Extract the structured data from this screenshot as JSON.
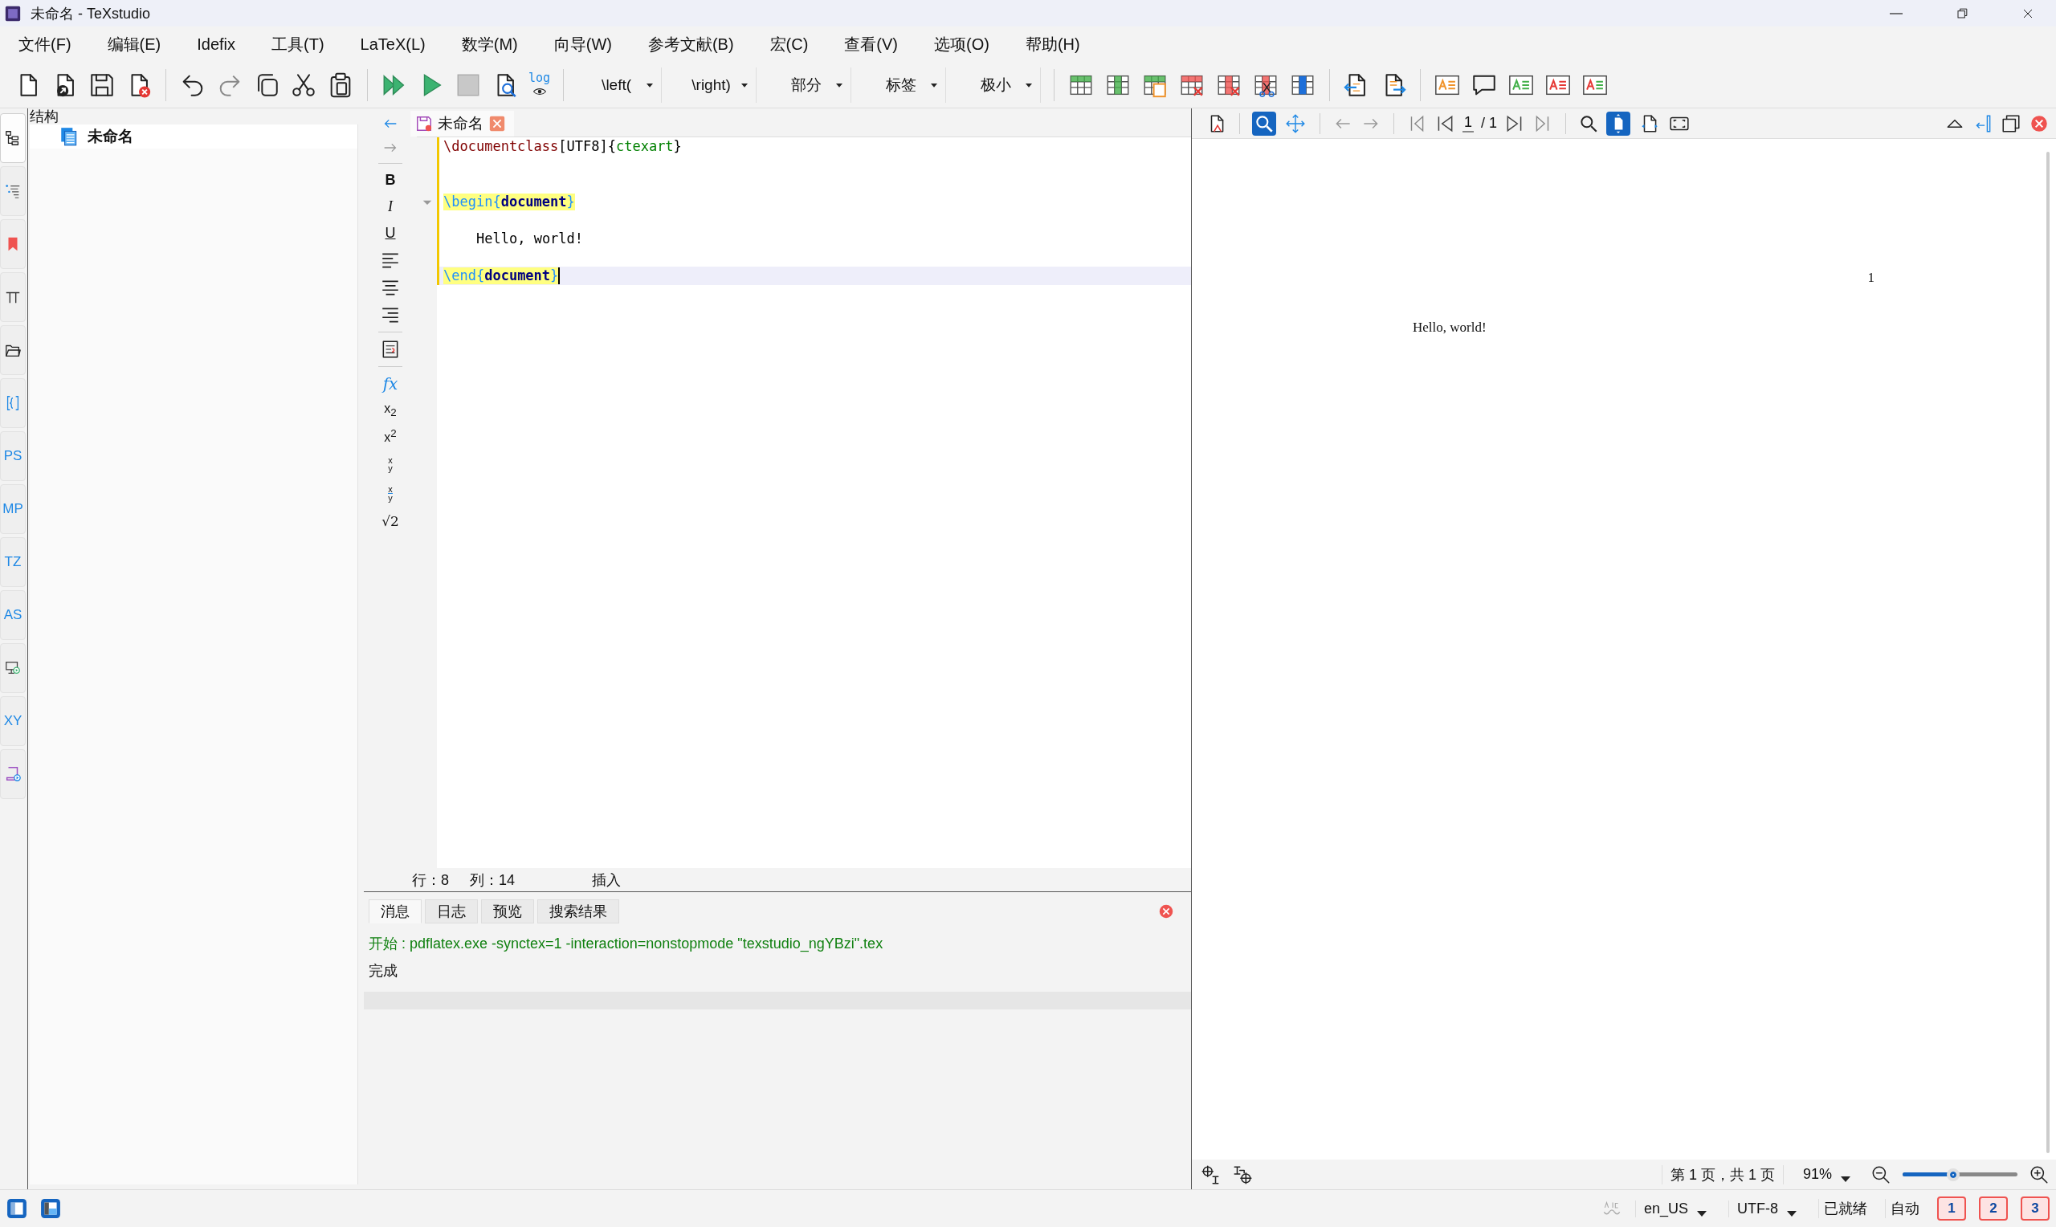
{
  "window": {
    "title": "未命名 - TeXstudio"
  },
  "menu": [
    "文件(F)",
    "编辑(E)",
    "Idefix",
    "工具(T)",
    "LaTeX(L)",
    "数学(M)",
    "向导(W)",
    "参考文献(B)",
    "宏(C)",
    "查看(V)",
    "选项(O)",
    "帮助(H)"
  ],
  "toolbar": {
    "log_label": "log",
    "dropdowns": [
      "\\left(",
      "\\right)",
      "部分",
      "标签",
      "极小"
    ]
  },
  "sidebar": {
    "tabs": [
      {
        "kind": "structure",
        "selected": true
      },
      {
        "kind": "toc",
        "selected": false
      },
      {
        "kind": "bookmark",
        "selected": false
      },
      {
        "kind": "symbols",
        "selected": false
      },
      {
        "kind": "files",
        "selected": false
      },
      {
        "kind": "braces",
        "selected": false
      },
      {
        "kind": "text",
        "label": "PS",
        "selected": false
      },
      {
        "kind": "text",
        "label": "MP",
        "selected": false
      },
      {
        "kind": "text",
        "label": "TZ",
        "selected": false
      },
      {
        "kind": "text",
        "label": "AS",
        "selected": false
      },
      {
        "kind": "presentation",
        "selected": false
      },
      {
        "kind": "text",
        "label": "XY",
        "selected": false
      },
      {
        "kind": "script",
        "selected": false
      }
    ]
  },
  "structure": {
    "title": "结构",
    "items": [
      {
        "label": "未命名"
      }
    ]
  },
  "editor": {
    "tabs": [
      {
        "label": "未命名"
      }
    ],
    "format_buttons": [
      "B",
      "I",
      "U"
    ],
    "math_buttons": [
      {
        "kind": "fx",
        "text": "fx"
      },
      {
        "kind": "sub",
        "text": "x$_{2}$"
      },
      {
        "kind": "sup",
        "text": "x$^{2}$"
      },
      {
        "kind": "frac",
        "num": "x",
        "den": "y"
      },
      {
        "kind": "dfrac",
        "num": "x",
        "den": "y"
      },
      {
        "kind": "sqrt",
        "text": "√2"
      }
    ],
    "lines": [
      {
        "tokens": [
          {
            "text": "\\documentclass",
            "kind": "class"
          },
          {
            "text": "[UTF8]{",
            "kind": "plain"
          },
          {
            "text": "ctexart",
            "kind": "arg"
          },
          {
            "text": "}",
            "kind": "plain"
          }
        ],
        "modified": true
      },
      {
        "modified": true
      },
      {
        "modified": true
      },
      {
        "tokens": [
          {
            "text": "\\begin{",
            "kind": "env"
          },
          {
            "text": "document",
            "kind": "envname"
          },
          {
            "text": "}",
            "kind": "env"
          }
        ],
        "modified": true,
        "foldable": true,
        "match_highlight": true
      },
      {
        "modified": true
      },
      {
        "tokens": [
          {
            "text": "Hello, world!",
            "kind": "plain"
          }
        ],
        "modified": true,
        "indented": true
      },
      {
        "modified": true
      },
      {
        "tokens": [
          {
            "text": "\\end{",
            "kind": "env"
          },
          {
            "text": "document",
            "kind": "envname"
          },
          {
            "text": "}",
            "kind": "env"
          }
        ],
        "modified": true,
        "match_highlight": true,
        "current": true
      }
    ],
    "position": {
      "line_label": "行：",
      "line": "8",
      "col_label": "列：",
      "col": "14",
      "mode": "插入"
    }
  },
  "messages": {
    "tabs": [
      {
        "label": "消息",
        "selected": true
      },
      {
        "label": "日志",
        "selected": false
      },
      {
        "label": "预览",
        "selected": false
      },
      {
        "label": "搜索结果",
        "selected": false
      }
    ],
    "lines": [
      {
        "kind": "info",
        "text": "开始 : pdflatex.exe -synctex=1 -interaction=nonstopmode \"texstudio_ngYBzi\".tex"
      },
      {
        "kind": "plain",
        "text": "完成"
      }
    ]
  },
  "pdf": {
    "tools": [
      {
        "kind": "magnifier",
        "selected": true
      },
      {
        "kind": "scroll",
        "selected": false
      }
    ],
    "page_input": "1",
    "page_total": "/ 1",
    "fit": [
      {
        "kind": "fit-page",
        "selected": true
      },
      {
        "kind": "fit-width",
        "selected": false
      }
    ],
    "page_number": "1",
    "body": "Hello, world!",
    "page_info": "第 1 页，共 1 页",
    "zoom": "91%",
    "zoom_slider": {
      "level": 0.44
    }
  },
  "status_bar": {
    "language": "en_US",
    "encoding": "UTF-8",
    "state": "已就绪",
    "mode": "自动",
    "bookmarks": [
      "1",
      "2",
      "3"
    ]
  }
}
